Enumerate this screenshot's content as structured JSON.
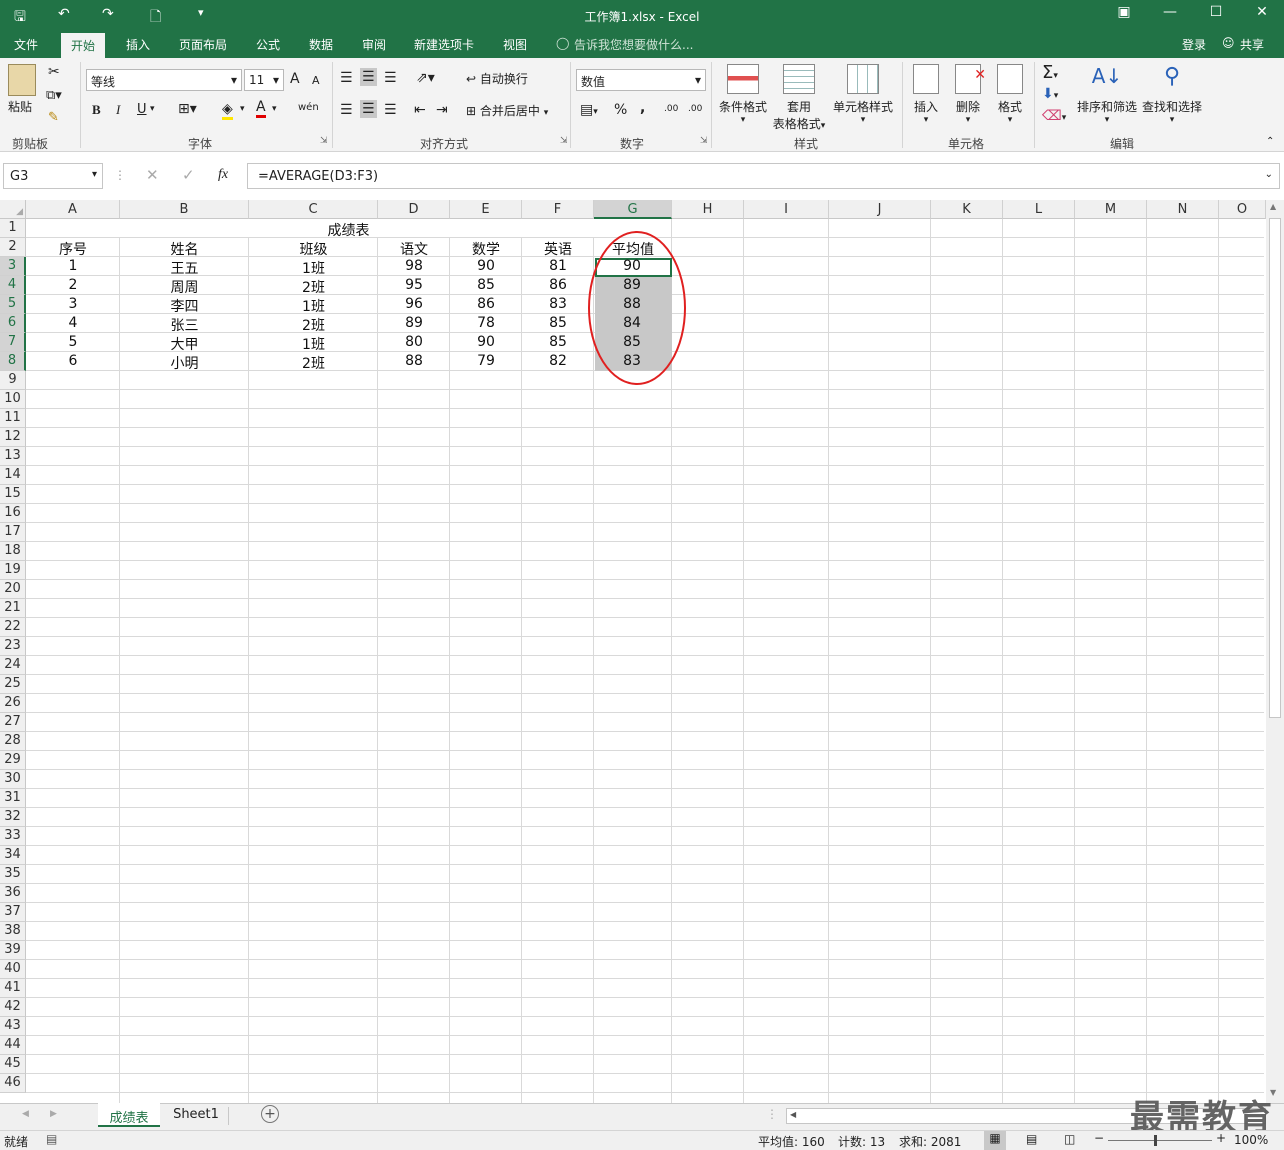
{
  "window": {
    "title": "工作簿1.xlsx - Excel"
  },
  "tabs": [
    "文件",
    "开始",
    "插入",
    "页面布局",
    "公式",
    "数据",
    "审阅",
    "新建选项卡",
    "视图"
  ],
  "tell_me": "告诉我您想要做什么...",
  "account": {
    "login": "登录",
    "share": "共享"
  },
  "ribbon": {
    "clipboard": {
      "paste": "粘贴",
      "label": "剪贴板"
    },
    "font": {
      "name": "等线",
      "size": "11",
      "label": "字体",
      "bold": "B",
      "italic": "I",
      "underline": "U",
      "grow": "A",
      "shrink": "A",
      "wen": "wén"
    },
    "alignment": {
      "wrap": "自动换行",
      "merge": "合并后居中",
      "label": "对齐方式"
    },
    "number": {
      "format": "数值",
      "percent": "%",
      "comma": ",",
      "inc": ".00",
      "dec": ".00",
      "label": "数字"
    },
    "styles": {
      "conditional": "条件格式",
      "table_line1": "套用",
      "table_line2": "表格格式",
      "cell": "单元格样式",
      "label": "样式"
    },
    "cells": {
      "insert": "插入",
      "delete": "删除",
      "format": "格式",
      "label": "单元格"
    },
    "editing": {
      "sort": "排序和筛选",
      "find": "查找和选择",
      "label": "编辑"
    }
  },
  "formula_bar": {
    "name_box": "G3",
    "formula": "=AVERAGE(D3:F3)",
    "fx": "fx"
  },
  "columns": [
    "A",
    "B",
    "C",
    "D",
    "E",
    "F",
    "G",
    "H",
    "I",
    "J",
    "K",
    "L",
    "M",
    "N",
    "O"
  ],
  "rows": [
    "1",
    "2",
    "3",
    "4",
    "5",
    "6",
    "7",
    "8",
    "9",
    "10",
    "11",
    "12",
    "13",
    "14",
    "15",
    "16",
    "17",
    "18",
    "19",
    "20",
    "21",
    "22",
    "23",
    "24",
    "25",
    "26",
    "27",
    "28",
    "29",
    "30",
    "31",
    "32",
    "33",
    "34",
    "35",
    "36",
    "37",
    "38",
    "39",
    "40",
    "41",
    "42",
    "43",
    "44",
    "45",
    "46"
  ],
  "sheet": {
    "title": "成绩表",
    "headers": [
      "序号",
      "姓名",
      "班级",
      "语文",
      "数学",
      "英语",
      "平均值"
    ],
    "data": [
      [
        "1",
        "王五",
        "1班",
        "98",
        "90",
        "81",
        "90"
      ],
      [
        "2",
        "周周",
        "2班",
        "95",
        "85",
        "86",
        "89"
      ],
      [
        "3",
        "李四",
        "1班",
        "96",
        "86",
        "83",
        "88"
      ],
      [
        "4",
        "张三",
        "2班",
        "89",
        "78",
        "85",
        "84"
      ],
      [
        "5",
        "大甲",
        "1班",
        "80",
        "90",
        "85",
        "85"
      ],
      [
        "6",
        "小明",
        "2班",
        "88",
        "79",
        "82",
        "83"
      ]
    ]
  },
  "sheet_tabs": {
    "active": "成绩表",
    "other": "Sheet1"
  },
  "status": {
    "ready": "就绪",
    "average": "平均值: 160",
    "count": "计数: 13",
    "sum": "求和: 2081",
    "zoom": "100%"
  },
  "watermark": "最需教育",
  "colors": {
    "excel_green": "#217346",
    "highlight_circle": "#e02020",
    "selection_fill": "#c8c8c8"
  }
}
